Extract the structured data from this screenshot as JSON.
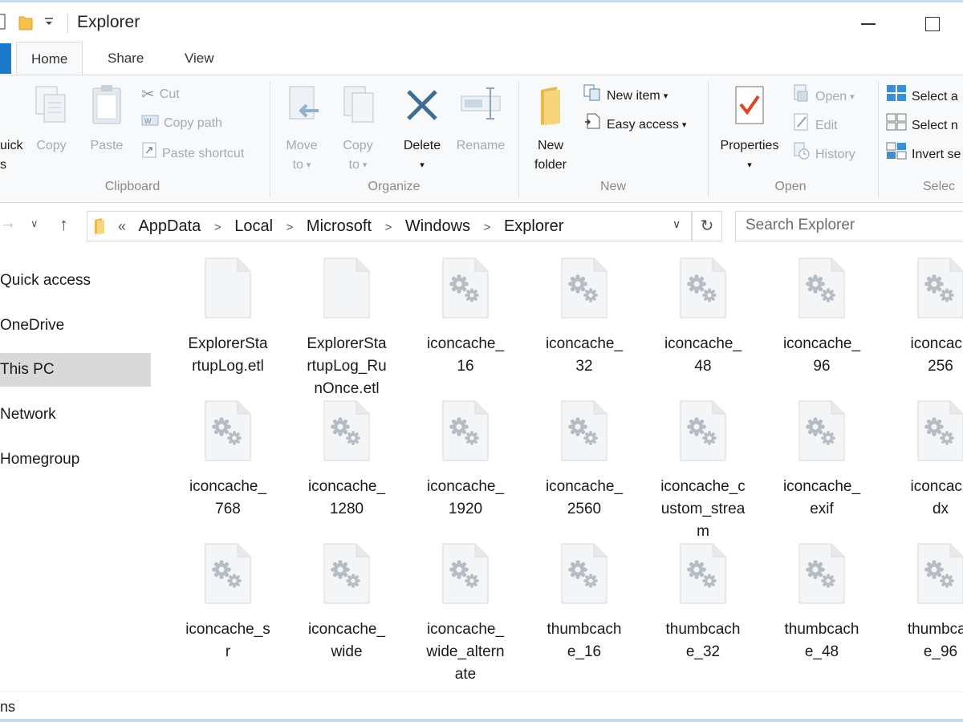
{
  "window": {
    "title": "Explorer"
  },
  "ribbon_tabs": [
    {
      "label": "Home",
      "active": true
    },
    {
      "label": "Share",
      "active": false
    },
    {
      "label": "View",
      "active": false
    }
  ],
  "ribbon": {
    "clipboard": {
      "label": "Clipboard",
      "pin_label_line1": "uick",
      "pin_label_line2": "s",
      "copy": "Copy",
      "paste": "Paste",
      "cut": "Cut",
      "copy_path": "Copy path",
      "paste_shortcut": "Paste shortcut"
    },
    "organize": {
      "label": "Organize",
      "move_to_line1": "Move",
      "move_to_line2": "to",
      "copy_to_line1": "Copy",
      "copy_to_line2": "to",
      "delete": "Delete",
      "rename": "Rename"
    },
    "new": {
      "label": "New",
      "new_folder_line1": "New",
      "new_folder_line2": "folder",
      "new_item": "New item",
      "easy_access": "Easy access"
    },
    "open": {
      "label": "Open",
      "properties": "Properties",
      "open": "Open",
      "edit": "Edit",
      "history": "History"
    },
    "select": {
      "label": "Selec",
      "select_all": "Select a",
      "select_none": "Select n",
      "invert": "Invert se"
    }
  },
  "address": {
    "overflow": "«",
    "crumbs": [
      "AppData",
      "Local",
      "Microsoft",
      "Windows",
      "Explorer"
    ]
  },
  "search": {
    "placeholder": "Search Explorer"
  },
  "nav_pane": [
    {
      "label": "Quick access",
      "selected": false
    },
    {
      "label": "OneDrive",
      "selected": false
    },
    {
      "label": "This PC",
      "selected": true
    },
    {
      "label": "Network",
      "selected": false
    },
    {
      "label": "Homegroup",
      "selected": false
    }
  ],
  "files": [
    {
      "name_lines": [
        "ExplorerSta",
        "rtupLog.etl"
      ],
      "icon": "blank-file-icon"
    },
    {
      "name_lines": [
        "ExplorerSta",
        "rtupLog_Ru",
        "nOnce.etl"
      ],
      "icon": "blank-file-icon"
    },
    {
      "name_lines": [
        "iconcache_",
        "16"
      ],
      "icon": "system-file-icon"
    },
    {
      "name_lines": [
        "iconcache_",
        "32"
      ],
      "icon": "system-file-icon"
    },
    {
      "name_lines": [
        "iconcache_",
        "48"
      ],
      "icon": "system-file-icon"
    },
    {
      "name_lines": [
        "iconcache_",
        "96"
      ],
      "icon": "system-file-icon"
    },
    {
      "name_lines": [
        "iconcach",
        "256"
      ],
      "icon": "system-file-icon"
    },
    {
      "name_lines": [
        "iconcache_",
        "768"
      ],
      "icon": "system-file-icon"
    },
    {
      "name_lines": [
        "iconcache_",
        "1280"
      ],
      "icon": "system-file-icon"
    },
    {
      "name_lines": [
        "iconcache_",
        "1920"
      ],
      "icon": "system-file-icon"
    },
    {
      "name_lines": [
        "iconcache_",
        "2560"
      ],
      "icon": "system-file-icon"
    },
    {
      "name_lines": [
        "iconcache_c",
        "ustom_strea",
        "m"
      ],
      "icon": "system-file-icon"
    },
    {
      "name_lines": [
        "iconcache_",
        "exif"
      ],
      "icon": "system-file-icon"
    },
    {
      "name_lines": [
        "iconcach",
        "dx"
      ],
      "icon": "system-file-icon"
    },
    {
      "name_lines": [
        "iconcache_s",
        "r"
      ],
      "icon": "system-file-icon"
    },
    {
      "name_lines": [
        "iconcache_",
        "wide"
      ],
      "icon": "system-file-icon"
    },
    {
      "name_lines": [
        "iconcache_",
        "wide_altern",
        "ate"
      ],
      "icon": "system-file-icon"
    },
    {
      "name_lines": [
        "thumbcach",
        "e_16"
      ],
      "icon": "system-file-icon"
    },
    {
      "name_lines": [
        "thumbcach",
        "e_32"
      ],
      "icon": "system-file-icon"
    },
    {
      "name_lines": [
        "thumbcach",
        "e_48"
      ],
      "icon": "system-file-icon"
    },
    {
      "name_lines": [
        "thumbcac",
        "e_96"
      ],
      "icon": "system-file-icon"
    }
  ],
  "status": {
    "text": "ns"
  },
  "colors": {
    "accent": "#1979ca",
    "selected_bg": "#d9d9d9",
    "ribbon_bg": "#f7f9fb"
  }
}
